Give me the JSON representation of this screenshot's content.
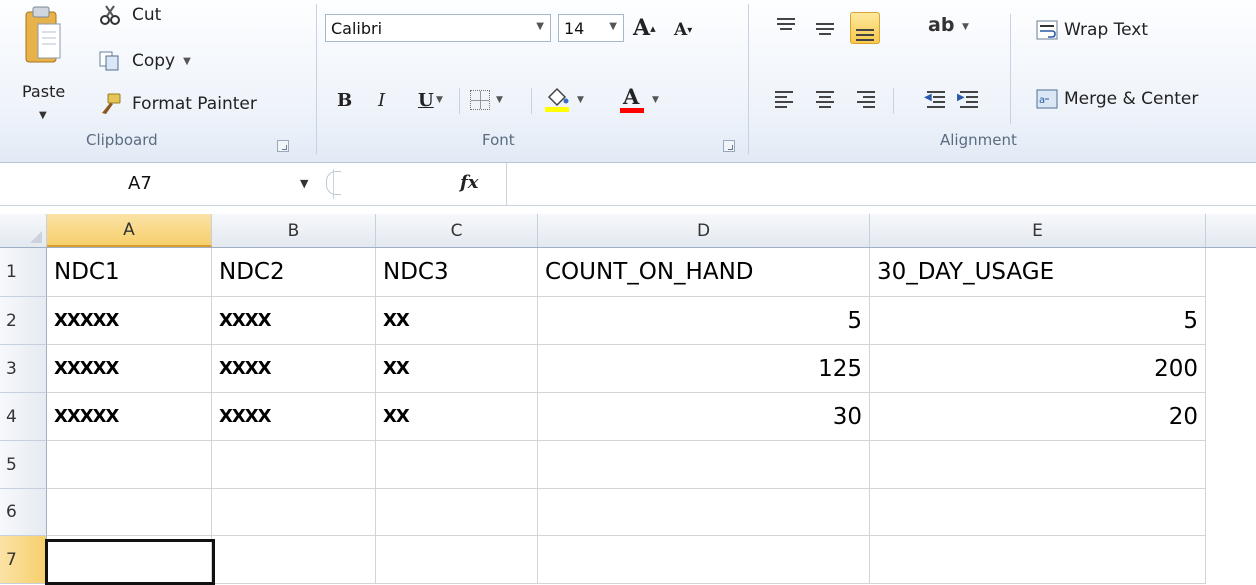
{
  "ribbon": {
    "clipboard": {
      "paste_label": "Paste",
      "cut_label": "Cut",
      "copy_label": "Copy",
      "format_painter_label": "Format Painter",
      "group_label": "Clipboard"
    },
    "font": {
      "font_name": "Calibri",
      "font_size": "14",
      "bold": "B",
      "italic": "I",
      "underline": "U",
      "group_label": "Font",
      "fill_color": "#ffff00",
      "font_color": "#ff0000"
    },
    "alignment": {
      "wrap_text_label": "Wrap Text",
      "merge_center_label": "Merge & Center",
      "group_label": "Alignment",
      "active_button": "bottom-align"
    }
  },
  "formula_bar": {
    "name_box": "A7",
    "fx_label": "fx",
    "formula": ""
  },
  "sheet": {
    "columns": [
      "A",
      "B",
      "C",
      "D",
      "E"
    ],
    "selected_column": "A",
    "row_numbers": [
      "1",
      "2",
      "3",
      "4",
      "5",
      "6",
      "7"
    ],
    "selected_row": "7",
    "rows": [
      [
        "NDC1",
        "NDC2",
        "NDC3",
        "COUNT_ON_HAND",
        "30_DAY_USAGE"
      ],
      [
        "XXXXX",
        "XXXX",
        "XX",
        "5",
        "5"
      ],
      [
        "XXXXX",
        "XXXX",
        "XX",
        "125",
        "200"
      ],
      [
        "XXXXX",
        "XXXX",
        "XX",
        "30",
        "20"
      ],
      [
        "",
        "",
        "",
        "",
        ""
      ],
      [
        "",
        "",
        "",
        "",
        ""
      ],
      [
        "",
        "",
        "",
        "",
        ""
      ]
    ],
    "active_cell": "A7"
  }
}
